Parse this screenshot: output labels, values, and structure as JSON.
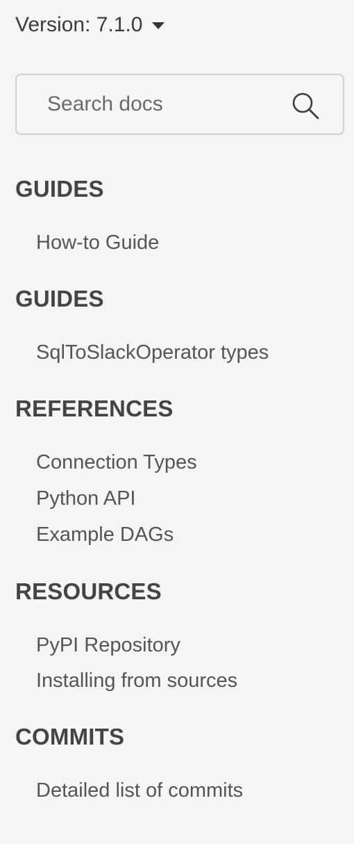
{
  "version": {
    "label": "Version: 7.1.0"
  },
  "search": {
    "placeholder": "Search docs"
  },
  "sections": [
    {
      "title": "GUIDES",
      "links": [
        "How-to Guide"
      ]
    },
    {
      "title": "GUIDES",
      "links": [
        "SqlToSlackOperator types"
      ]
    },
    {
      "title": "REFERENCES",
      "links": [
        "Connection Types",
        "Python API",
        "Example DAGs"
      ]
    },
    {
      "title": "RESOURCES",
      "links": [
        "PyPI Repository",
        "Installing from sources"
      ]
    },
    {
      "title": "COMMITS",
      "links": [
        "Detailed list of commits"
      ]
    }
  ],
  "icons": {
    "version_caret": "caret-down-icon",
    "search": "search-icon"
  },
  "colors": {
    "background": "#f5f5f5",
    "heading": "#444444",
    "link": "#555555",
    "search_border": "#cfcfcf"
  }
}
